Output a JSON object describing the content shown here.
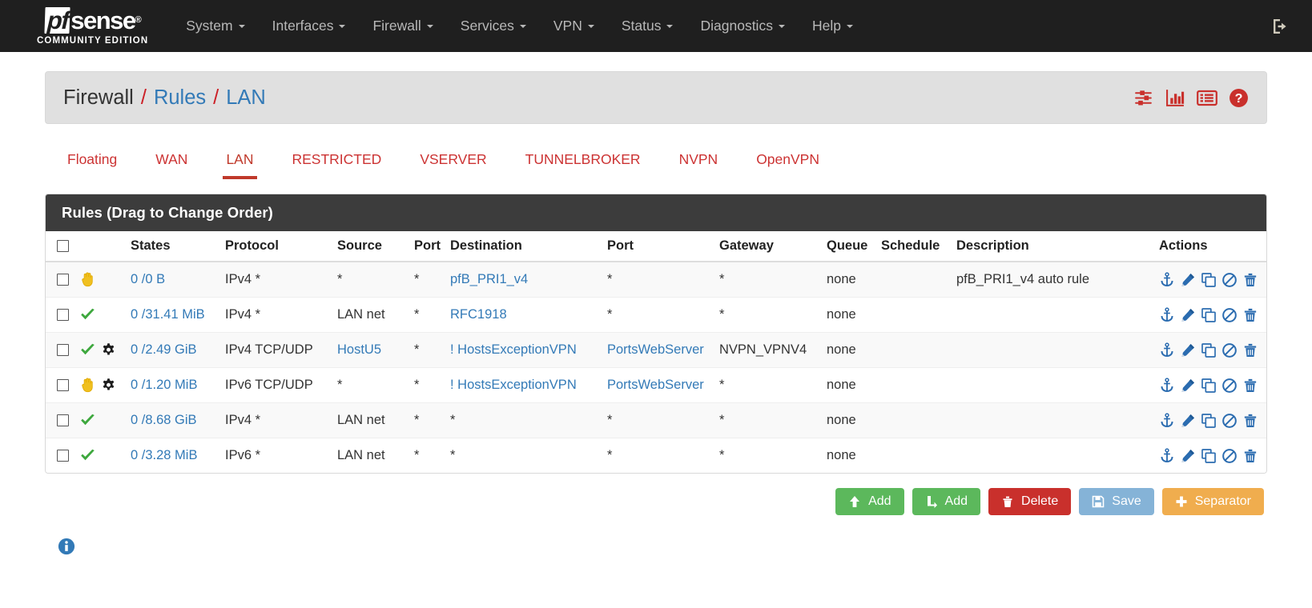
{
  "brand": {
    "logo_pf": "pf",
    "logo_sense": "sense",
    "reg": "®",
    "subtitle": "COMMUNITY EDITION"
  },
  "navbar": {
    "items": [
      {
        "label": "System",
        "caret": true
      },
      {
        "label": "Interfaces",
        "caret": true
      },
      {
        "label": "Firewall",
        "caret": true
      },
      {
        "label": "Services",
        "caret": true
      },
      {
        "label": "VPN",
        "caret": true
      },
      {
        "label": "Status",
        "caret": true
      },
      {
        "label": "Diagnostics",
        "caret": true
      },
      {
        "label": "Help",
        "caret": true
      }
    ],
    "logout_icon": "logout-icon"
  },
  "breadcrumb": {
    "part1": "Firewall",
    "sep1": "/",
    "part2": "Rules",
    "sep2": "/",
    "part3": "LAN",
    "icons": [
      "sliders-icon",
      "bar-chart-icon",
      "list-icon",
      "help-icon"
    ]
  },
  "tabs": [
    {
      "label": "Floating",
      "active": false
    },
    {
      "label": "WAN",
      "active": false
    },
    {
      "label": "LAN",
      "active": true
    },
    {
      "label": "RESTRICTED",
      "active": false
    },
    {
      "label": "VSERVER",
      "active": false
    },
    {
      "label": "TUNNELBROKER",
      "active": false
    },
    {
      "label": "NVPN",
      "active": false
    },
    {
      "label": "OpenVPN",
      "active": false
    }
  ],
  "panel": {
    "heading": "Rules (Drag to Change Order)",
    "columns": {
      "checkbox": "",
      "state": "",
      "states": "States",
      "protocol": "Protocol",
      "source": "Source",
      "src_port": "Port",
      "destination": "Destination",
      "dst_port": "Port",
      "gateway": "Gateway",
      "queue": "Queue",
      "schedule": "Schedule",
      "description": "Description",
      "actions": "Actions"
    },
    "rows": [
      {
        "state_icon": "block-hand-icon",
        "advanced_icon": false,
        "states": "0 /0 B",
        "protocol": "IPv4 *",
        "source": "*",
        "source_link": false,
        "src_port": "*",
        "destination": "pfB_PRI1_v4",
        "destination_link": true,
        "dst_port": "*",
        "dst_port_link": false,
        "gateway": "*",
        "queue": "none",
        "schedule": "",
        "description": "pfB_PRI1_v4 auto rule"
      },
      {
        "state_icon": "pass-check-icon",
        "advanced_icon": false,
        "states": "0 /31.41 MiB",
        "protocol": "IPv4 *",
        "source": "LAN net",
        "source_link": false,
        "src_port": "*",
        "destination": "RFC1918",
        "destination_link": true,
        "dst_port": "*",
        "dst_port_link": false,
        "gateway": "*",
        "queue": "none",
        "schedule": "",
        "description": ""
      },
      {
        "state_icon": "pass-check-icon",
        "advanced_icon": true,
        "states": "0 /2.49 GiB",
        "protocol": "IPv4 TCP/UDP",
        "source": "HostU5",
        "source_link": true,
        "src_port": "*",
        "destination": "! HostsExceptionVPN",
        "destination_link": true,
        "dst_port": "PortsWebServer",
        "dst_port_link": true,
        "gateway": "NVPN_VPNV4",
        "queue": "none",
        "schedule": "",
        "description": ""
      },
      {
        "state_icon": "block-hand-icon",
        "advanced_icon": true,
        "states": "0 /1.20 MiB",
        "protocol": "IPv6 TCP/UDP",
        "source": "*",
        "source_link": false,
        "src_port": "*",
        "destination": "! HostsExceptionVPN",
        "destination_link": true,
        "dst_port": "PortsWebServer",
        "dst_port_link": true,
        "gateway": "*",
        "queue": "none",
        "schedule": "",
        "description": ""
      },
      {
        "state_icon": "pass-check-icon",
        "advanced_icon": false,
        "states": "0 /8.68 GiB",
        "protocol": "IPv4 *",
        "source": "LAN net",
        "source_link": false,
        "src_port": "*",
        "destination": "*",
        "destination_link": false,
        "dst_port": "*",
        "dst_port_link": false,
        "gateway": "*",
        "queue": "none",
        "schedule": "",
        "description": ""
      },
      {
        "state_icon": "pass-check-icon",
        "advanced_icon": false,
        "states": "0 /3.28 MiB",
        "protocol": "IPv6 *",
        "source": "LAN net",
        "source_link": false,
        "src_port": "*",
        "destination": "*",
        "destination_link": false,
        "dst_port": "*",
        "dst_port_link": false,
        "gateway": "*",
        "queue": "none",
        "schedule": "",
        "description": ""
      }
    ],
    "row_action_icons": [
      "anchor-icon",
      "pencil-icon",
      "copy-icon",
      "block-icon",
      "trash-icon"
    ]
  },
  "buttons": [
    {
      "label": "Add",
      "icon": "arrow-up-icon",
      "style": "green"
    },
    {
      "label": "Add",
      "icon": "arrow-down-icon",
      "style": "green"
    },
    {
      "label": "Delete",
      "icon": "trash-icon",
      "style": "red"
    },
    {
      "label": "Save",
      "icon": "save-icon",
      "style": "blue"
    },
    {
      "label": "Separator",
      "icon": "plus-icon",
      "style": "orange"
    }
  ],
  "footer": {
    "info_icon": "info-icon"
  },
  "colors": {
    "navbar_bg": "#1f1f1f",
    "accent_red": "#cc2027",
    "link_blue": "#337ab7",
    "panel_heading_bg": "#3c3c3c",
    "pass_green": "#3ea83e",
    "block_yellow": "#f0c020"
  }
}
